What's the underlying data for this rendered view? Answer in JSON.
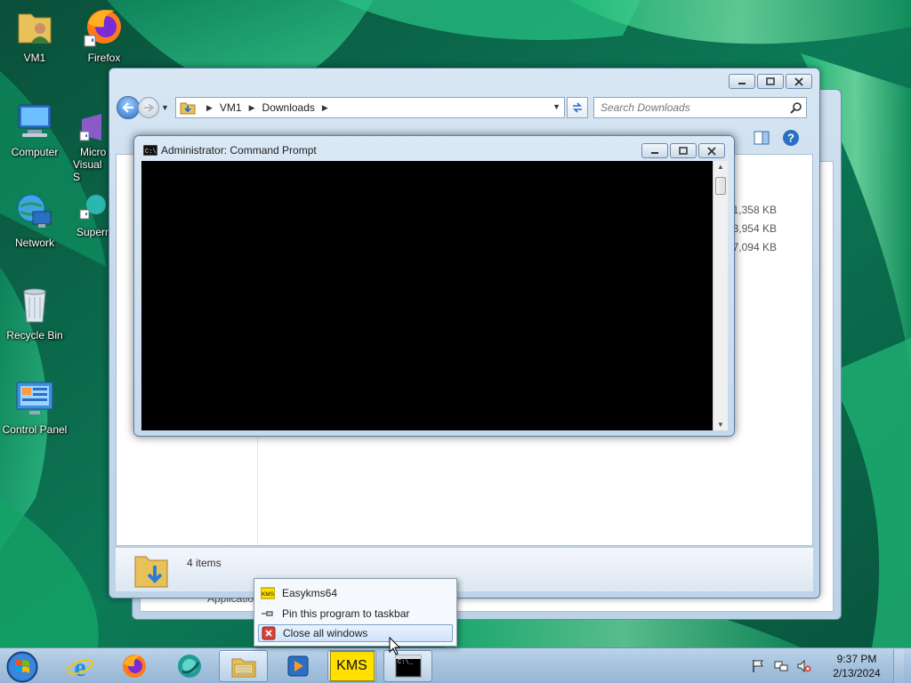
{
  "desktop_icons": [
    {
      "label": "VM1",
      "icon": "user-folder-icon"
    },
    {
      "label": "Firefox",
      "icon": "firefox-icon"
    },
    {
      "label": "Computer",
      "icon": "computer-icon"
    },
    {
      "label": "Micro",
      "label2": "Visual S",
      "icon": "visual-studio-shortcut-icon"
    },
    {
      "label": "Network",
      "icon": "network-icon"
    },
    {
      "label": "Supern",
      "icon": "supernote-shortcut-icon"
    },
    {
      "label": "Recycle Bin",
      "icon": "recycle-bin-icon"
    },
    {
      "label": "Control Panel",
      "icon": "control-panel-icon"
    }
  ],
  "explorer": {
    "address": {
      "crumbs": [
        "VM1",
        "Downloads"
      ]
    },
    "search_placeholder": "Search Downloads",
    "file_sizes": [
      "1,358 KB",
      "3,954 KB",
      "7,094 KB"
    ],
    "item_count": "4 items",
    "behind_window_text": "Applicatio"
  },
  "cmd": {
    "title": "Administrator:  Command Prompt"
  },
  "jumplist": {
    "items": [
      {
        "label": "Easykms64",
        "icon": "kms-icon"
      },
      {
        "label": "Pin this program to taskbar",
        "icon": "pin-icon"
      },
      {
        "label": "Close all windows",
        "icon": "close-red-icon"
      }
    ]
  },
  "taskbar": {
    "kms_label": "KMS",
    "time": "9:37 PM",
    "date": "2/13/2024"
  },
  "colors": {
    "taskbar": "#a6c2de",
    "console_bg": "#000000",
    "kms_yellow": "#ffe000"
  }
}
